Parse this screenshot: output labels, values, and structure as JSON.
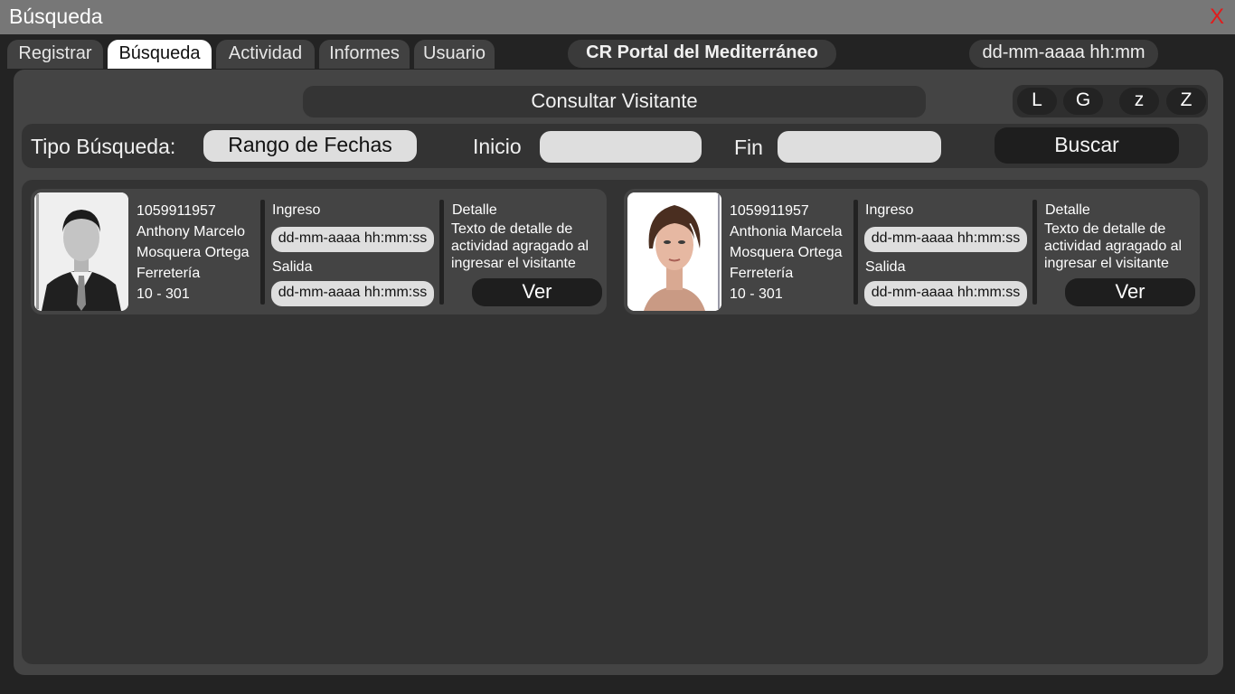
{
  "window": {
    "title": "Búsqueda",
    "close_label": "X"
  },
  "tabs": [
    {
      "label": "Registrar"
    },
    {
      "label": "Búsqueda"
    },
    {
      "label": "Actividad"
    },
    {
      "label": "Informes"
    },
    {
      "label": "Usuario"
    }
  ],
  "header": {
    "org": "CR Portal del Mediterráneo",
    "datetime": "dd-mm-aaaa hh:mm"
  },
  "panel": {
    "title": "Consultar Visitante"
  },
  "zoom": [
    "L",
    "G",
    "z",
    "Z"
  ],
  "filter": {
    "type_label": "Tipo Búsqueda:",
    "type_value": "Rango de Fechas",
    "start_label": "Inicio",
    "start_value": "",
    "end_label": "Fin",
    "end_value": "",
    "search_label": "Buscar"
  },
  "results": [
    {
      "id": "1059911957",
      "name1": "Anthony Marcelo",
      "name2": "Mosquera Ortega",
      "company": "Ferretería",
      "unit": "10 - 301",
      "in_label": "Ingreso",
      "in_value": "dd-mm-aaaa hh:mm:ss",
      "out_label": "Salida",
      "out_value": "dd-mm-aaaa hh:mm:ss",
      "detail_label": "Detalle",
      "detail_text": "Texto de detalle de actividad agragado al ingresar el visitante",
      "view_label": "Ver"
    },
    {
      "id": "1059911957",
      "name1": "Anthonia Marcela",
      "name2": "Mosquera Ortega",
      "company": "Ferretería",
      "unit": "10 - 301",
      "in_label": "Ingreso",
      "in_value": "dd-mm-aaaa hh:mm:ss",
      "out_label": "Salida",
      "out_value": "dd-mm-aaaa hh:mm:ss",
      "detail_label": "Detalle",
      "detail_text": "Texto de detalle de actividad agragado al ingresar el visitante",
      "view_label": "Ver"
    }
  ],
  "colors": {
    "close": "#e21b1b",
    "titlebar": "#777777",
    "panel": "#444444",
    "field": "#dedede"
  }
}
